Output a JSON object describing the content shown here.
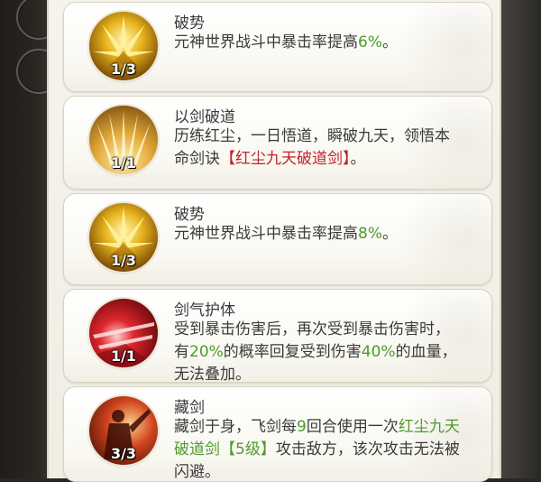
{
  "skills": [
    {
      "name": "破势",
      "level": "1/3",
      "icon": "golden-burst-icon",
      "desc": [
        {
          "t": "元神世界战斗中暴击率提高"
        },
        {
          "t": "6%",
          "c": "green"
        },
        {
          "t": "。"
        }
      ]
    },
    {
      "name": "以剑破道",
      "level": "1/1",
      "icon": "golden-rays-icon",
      "desc": [
        {
          "t": "历练红尘，一日悟道，瞬破九天，领悟本命剑诀"
        },
        {
          "t": "【红尘九天破道剑】",
          "c": "red"
        },
        {
          "t": "。"
        }
      ]
    },
    {
      "name": "破势",
      "level": "1/3",
      "icon": "golden-burst-icon",
      "desc": [
        {
          "t": "元神世界战斗中暴击率提高"
        },
        {
          "t": "8%",
          "c": "green"
        },
        {
          "t": "。"
        }
      ]
    },
    {
      "name": "剑气护体",
      "level": "1/1",
      "icon": "red-sword-qi-icon",
      "desc": [
        {
          "t": "受到暴击伤害后，再次受到暴击伤害时，有"
        },
        {
          "t": "20%",
          "c": "green"
        },
        {
          "t": "的概率回复受到伤害"
        },
        {
          "t": "40%",
          "c": "green"
        },
        {
          "t": "的血量，无法叠加。"
        }
      ]
    },
    {
      "name": "藏剑",
      "level": "3/3",
      "icon": "hidden-sword-figure-icon",
      "desc": [
        {
          "t": "藏剑于身，飞剑每"
        },
        {
          "t": "9",
          "c": "green"
        },
        {
          "t": "回合使用一次"
        },
        {
          "t": "红尘九天破道剑【5级】",
          "c": "green"
        },
        {
          "t": "攻击敌方，该次攻击无法被闪避。"
        }
      ]
    }
  ],
  "colors": {
    "highlight_green": "#4f9a2d",
    "highlight_red": "#c0232b",
    "text": "#3a3a3a"
  }
}
